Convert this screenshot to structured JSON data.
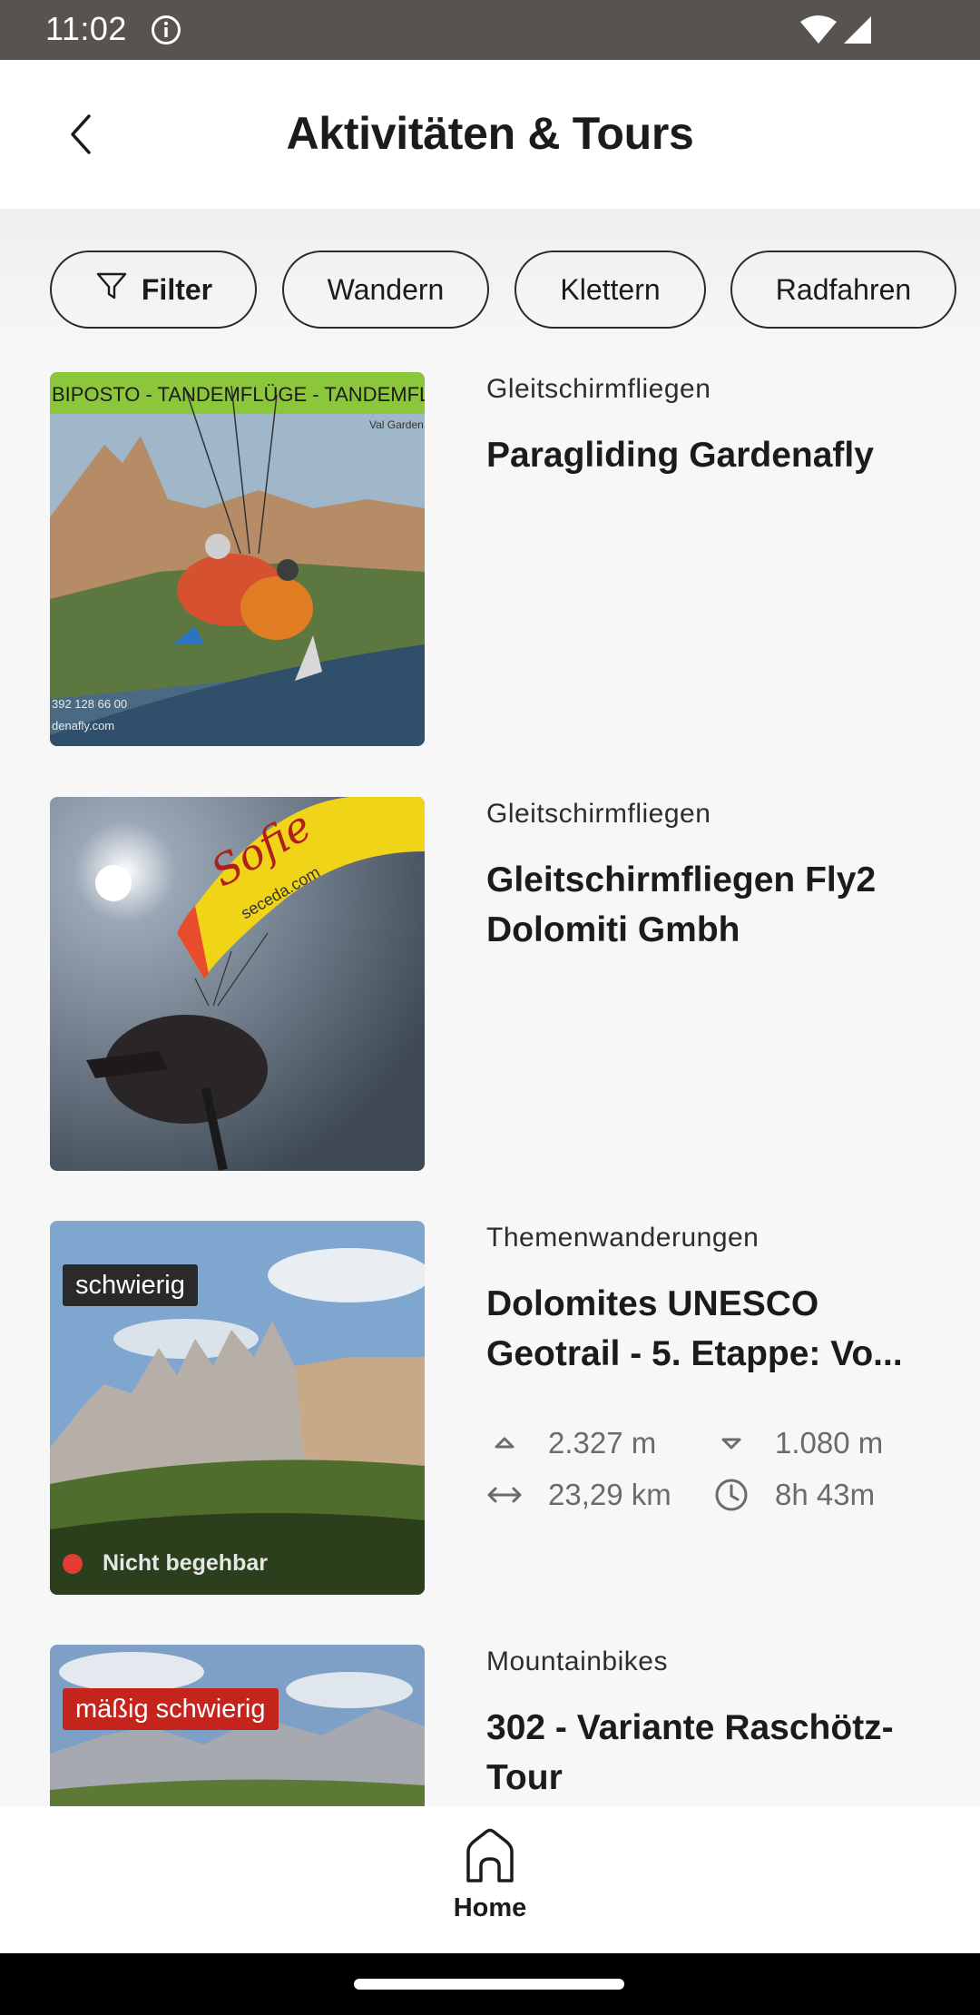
{
  "status_bar": {
    "time": "11:02"
  },
  "header": {
    "title": "Aktivitäten & Tours"
  },
  "filters": {
    "filter_label": "Filter",
    "chips": [
      "Wandern",
      "Klettern",
      "Radfahren"
    ]
  },
  "items": [
    {
      "category": "Gleitschirmfliegen",
      "title": "Paragliding Gardenafly",
      "image_text": {
        "banner": "BIPOSTO - TANDEMFLÜGE - TANDEMFLI",
        "sub": "Val Garden",
        "phone": "392 128 66 00",
        "web": "denafly.com"
      }
    },
    {
      "category": "Gleitschirmfliegen",
      "title": "Gleitschirmfliegen Fly2 Dolomiti Gmbh",
      "image_text": {
        "wing": "Sofie",
        "wing_sub": "seceda.com"
      }
    },
    {
      "category": "Themenwanderungen",
      "title": "Dolomites UNESCO Geotrail - 5. Etappe: Vo...",
      "badge": "schwierig",
      "status": "Nicht begehbar",
      "stats": {
        "ascent": "2.327 m",
        "descent": "1.080 m",
        "distance": "23,29 km",
        "duration": "8h 43m"
      }
    },
    {
      "category": "Mountainbikes",
      "title": "302 - Variante Raschötz-Tour",
      "badge": "mäßig schwierig"
    }
  ],
  "bottom_nav": {
    "home_label": "Home"
  },
  "colors": {
    "status_bar": "#575450",
    "badge_red": "#c4241c",
    "badge_dark": "#2a2a2a",
    "status_dot": "#e53b35"
  }
}
